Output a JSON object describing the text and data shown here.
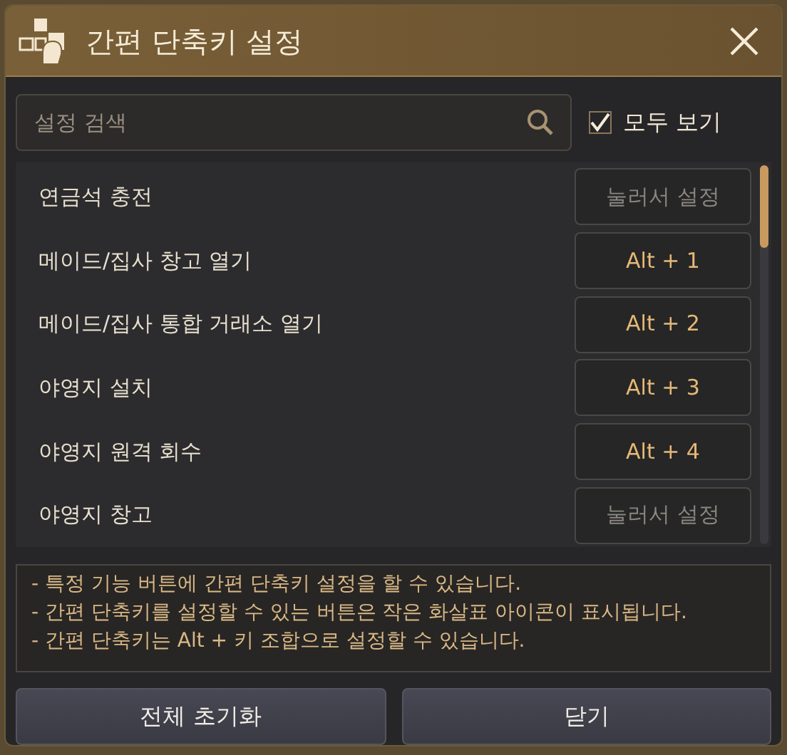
{
  "window": {
    "title": "간편 단축키 설정"
  },
  "search": {
    "placeholder": "설정 검색"
  },
  "show_all": {
    "label": "모두 보기",
    "checked": true
  },
  "shortcuts": [
    {
      "name": "연금석 충전",
      "binding": "눌러서 설정",
      "set": false
    },
    {
      "name": "메이드/집사 창고 열기",
      "binding": "Alt + 1",
      "set": true
    },
    {
      "name": "메이드/집사 통합 거래소 열기",
      "binding": "Alt + 2",
      "set": true
    },
    {
      "name": "야영지 설치",
      "binding": "Alt + 3",
      "set": true
    },
    {
      "name": "야영지 원격 회수",
      "binding": "Alt + 4",
      "set": true
    },
    {
      "name": "야영지 창고",
      "binding": "눌러서 설정",
      "set": false
    }
  ],
  "notes": [
    "- 특정 기능 버튼에 간편 단축키 설정을 할 수 있습니다.",
    "- 간편 단축키를 설정할 수 있는 버튼은 작은 화살표 아이콘이 표시됩니다.",
    "- 간편 단축키는 Alt + 키 조합으로 설정할 수 있습니다."
  ],
  "buttons": [
    "전체 초기화",
    "닫기"
  ]
}
